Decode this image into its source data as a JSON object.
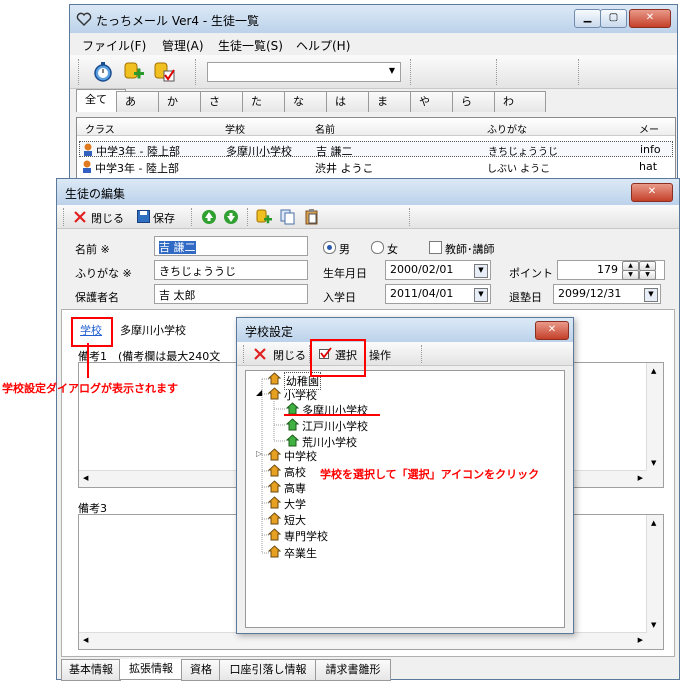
{
  "main_window": {
    "title": "たっちメール Ver4 - 生徒一覧",
    "menus": [
      "ファイル(F)",
      "管理(A)",
      "生徒一覧(S)",
      "ヘルプ(H)"
    ],
    "filter_tabs": [
      "全て",
      "あ",
      "か",
      "さ",
      "た",
      "な",
      "は",
      "ま",
      "や",
      "ら",
      "わ"
    ],
    "columns": [
      "クラス",
      "学校",
      "名前",
      "ふりがな",
      "メー"
    ],
    "rows": [
      {
        "class": "中学3年 - 陸上部",
        "school": "多摩川小学校",
        "name": "吉 謙二",
        "kana": "きちじょううじ",
        "mail": "info"
      },
      {
        "class": "中学3年 - 陸上部",
        "school": "",
        "name": "渋井 ようこ",
        "kana": "しぶい ようこ",
        "mail": "hat"
      }
    ]
  },
  "edit_window": {
    "title": "生徒の編集",
    "toolbar": {
      "close": "閉じる",
      "save": "保存"
    },
    "fields": {
      "name_label": "名前 ※",
      "name_value": "吉 謙二",
      "kana_label": "ふりがな ※",
      "kana_value": "きちじょううじ",
      "guardian_label": "保護者名",
      "guardian_value": "吉 太郎",
      "male": "男",
      "female": "女",
      "teacher": "教師･講師",
      "birth_label": "生年月日",
      "birth_value": "2000/02/01",
      "point_label": "ポイント",
      "point_value": "179",
      "enroll_label": "入学日",
      "enroll_value": "2011/04/01",
      "leave_label": "退塾日",
      "leave_value": "2099/12/31"
    },
    "school_link": "学校",
    "school_value": "多摩川小学校",
    "memo1_label": "備考1　(備考欄は最大240文",
    "memo3_label": "備考3",
    "bottom_tabs": [
      "基本情報",
      "拡張情報",
      "資格",
      "口座引落し情報",
      "請求書雛形"
    ]
  },
  "school_dialog": {
    "title": "学校設定",
    "toolbar": {
      "close": "閉じる",
      "select": "選択",
      "operate": "操作"
    },
    "tree": [
      "幼稚園",
      "小学校",
      "多摩川小学校",
      "江戸川小学校",
      "荒川小学校",
      "中学校",
      "高校",
      "高専",
      "大学",
      "短大",
      "専門学校",
      "卒業生"
    ]
  },
  "annotations": {
    "dialog_shown": "学校設定ダイアログが表示されます",
    "select_hint": "学校を選択して「選択」アイコンをクリック"
  },
  "colors": {
    "accent": "#ff0000",
    "selection": "#316ac5"
  }
}
